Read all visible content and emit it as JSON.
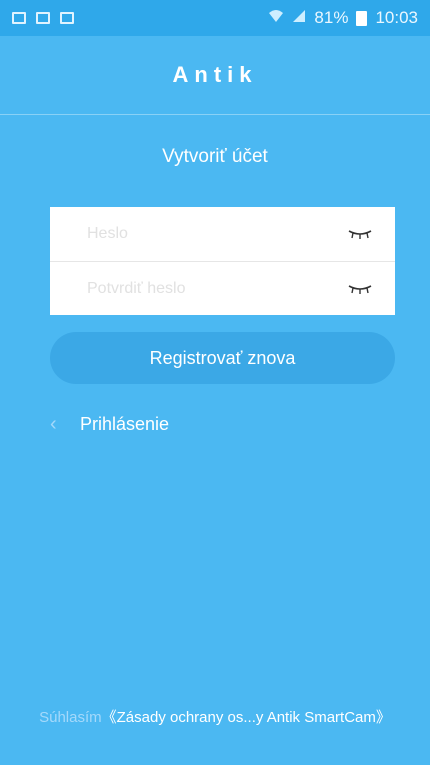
{
  "status_bar": {
    "battery_percent": "81%",
    "time": "10:03",
    "left_icons": [
      "screenshot-icon",
      "gallery-icon",
      "message-icon"
    ]
  },
  "header": {
    "title": "Antik"
  },
  "page": {
    "subtitle": "Vytvoriť účet"
  },
  "form": {
    "password_placeholder": "Heslo",
    "confirm_placeholder": "Potvrdiť heslo"
  },
  "actions": {
    "register_label": "Registrovať znova",
    "login_label": "Prihlásenie"
  },
  "footer": {
    "agree_prefix": "Súhlasím",
    "policy_link": "《Zásady ochrany os...y Antik SmartCam》"
  },
  "colors": {
    "background": "#4bb8f2",
    "status_bar": "#2fa8ea",
    "button": "#3ba8e6",
    "text": "#ffffff"
  }
}
